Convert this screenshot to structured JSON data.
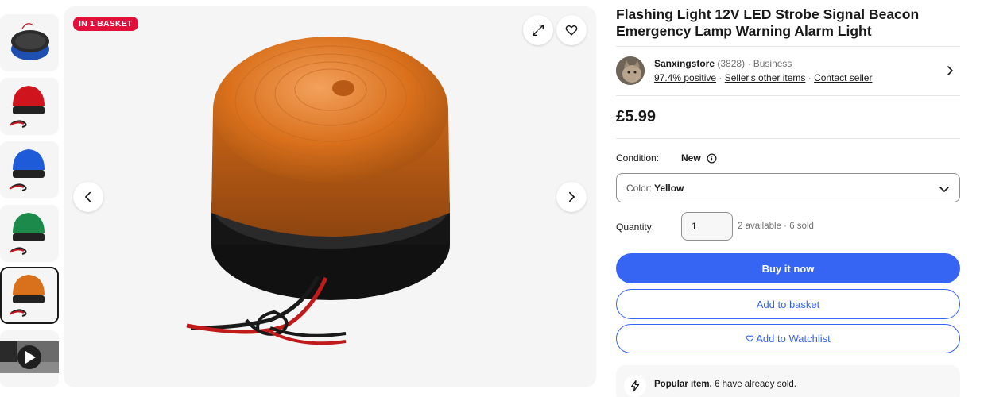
{
  "badge": {
    "in_basket": "IN 1 BASKET"
  },
  "thumbnails": [
    {
      "color": "#1f4fb0",
      "label": "blue-beacon-top"
    },
    {
      "color": "#d0141e",
      "label": "red-beacon"
    },
    {
      "color": "#1e5bd8",
      "label": "blue-beacon"
    },
    {
      "color": "#1b8a4a",
      "label": "green-beacon"
    },
    {
      "color": "#d9701c",
      "label": "yellow-beacon",
      "selected": true
    },
    {
      "color": "#333333",
      "label": "video"
    }
  ],
  "product": {
    "title": "Flashing Light 12V LED Strobe Signal Beacon Emergency Lamp Warning Alarm Light",
    "price": "£5.99"
  },
  "seller": {
    "name": "Sanxingstore",
    "feedback_count": "(3828)",
    "type": "· Business",
    "positive": "97.4% positive",
    "sep1": "·",
    "other_items": "Seller's other items",
    "sep2": "·",
    "contact": "Contact seller"
  },
  "condition": {
    "label": "Condition:",
    "value": "New"
  },
  "color_select": {
    "label": "Color:",
    "value": "Yellow"
  },
  "quantity": {
    "label": "Quantity:",
    "value": "1",
    "availability": "2 available · 6 sold"
  },
  "buttons": {
    "buy_now": "Buy it now",
    "add_to_basket": "Add to basket",
    "add_to_watchlist": "Add to Watchlist"
  },
  "popular": {
    "title": "Popular item.",
    "text": "6 have already sold."
  },
  "icons": {
    "expand": "expand-icon",
    "heart": "heart-icon",
    "prev": "chevron-left-icon",
    "next": "chevron-right-icon",
    "info": "info-icon",
    "dropdown": "chevron-down-icon",
    "lightning": "lightning-icon",
    "play": "play-icon"
  },
  "colors": {
    "accent": "#3665f3",
    "badge": "#e0103a",
    "beacon_amber": "#d9701c"
  }
}
